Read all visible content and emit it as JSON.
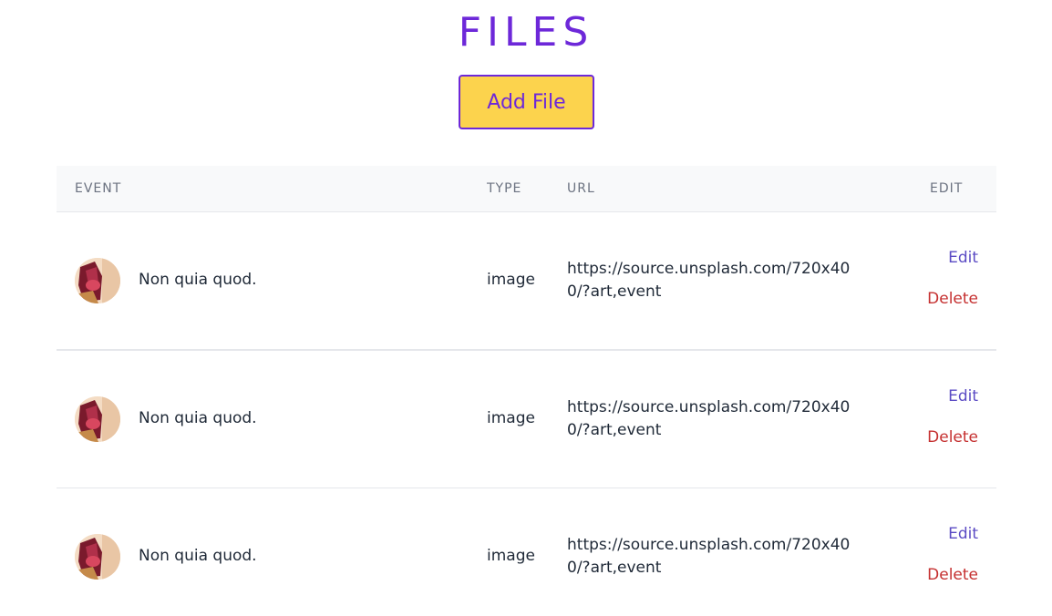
{
  "page": {
    "title": "FILES",
    "add_button_label": "Add File"
  },
  "table": {
    "headers": {
      "event": "EVENT",
      "type": "TYPE",
      "url": "URL",
      "edit": "EDIT"
    },
    "rows": [
      {
        "event": "Non quia quod.",
        "type": "image",
        "url": "https://source.unsplash.com/720x400/?art,event",
        "edit_label": "Edit",
        "delete_label": "Delete"
      },
      {
        "event": "Non quia quod.",
        "type": "image",
        "url": "https://source.unsplash.com/720x400/?art,event",
        "edit_label": "Edit",
        "delete_label": "Delete"
      },
      {
        "event": "Non quia quod.",
        "type": "image",
        "url": "https://source.unsplash.com/720x400/?art,event",
        "edit_label": "Edit",
        "delete_label": "Delete"
      }
    ]
  },
  "colors": {
    "accent": "#6d28d9",
    "button_bg": "#fcd34d",
    "edit": "#5b4bc4",
    "delete": "#c53030",
    "header_bg": "#f8f9fa"
  },
  "icons": {
    "avatar": "event-thumbnail-image"
  }
}
